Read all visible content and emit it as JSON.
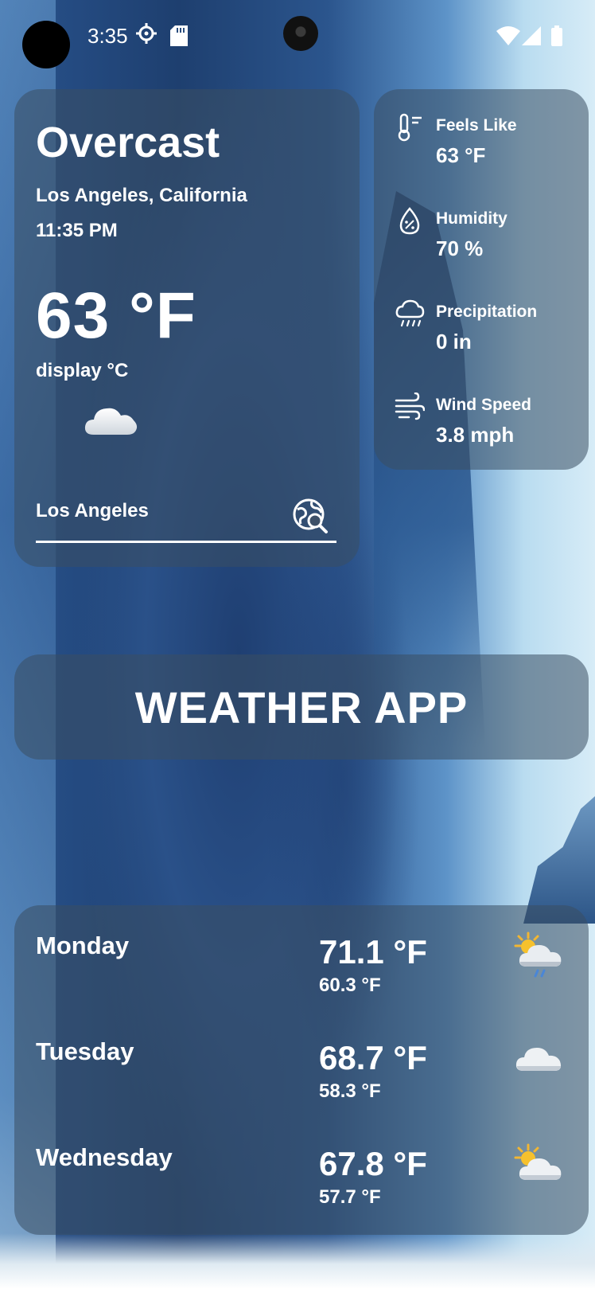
{
  "status_bar": {
    "time": "3:35"
  },
  "current": {
    "condition": "Overcast",
    "location": "Los Angeles, California",
    "local_time": "11:35 PM",
    "temperature": "63 °F",
    "unit_toggle_label": "display °C",
    "search_value": "Los Angeles",
    "weather_icon": "cloud-icon"
  },
  "details": [
    {
      "label": "Feels Like",
      "value": "63 °F",
      "icon": "thermometer-icon"
    },
    {
      "label": "Humidity",
      "value": "70 %",
      "icon": "humidity-drop-icon"
    },
    {
      "label": "Precipitation",
      "value": "0 in",
      "icon": "rain-cloud-icon"
    },
    {
      "label": "Wind Speed",
      "value": "3.8 mph",
      "icon": "wind-icon"
    }
  ],
  "banner": {
    "title": "WEATHER APP"
  },
  "forecast": [
    {
      "day": "Monday",
      "high": "71.1 °F",
      "low": "60.3 °F",
      "icon": "sun-cloud-rain-icon"
    },
    {
      "day": "Tuesday",
      "high": "68.7 °F",
      "low": "58.3 °F",
      "icon": "cloud-icon"
    },
    {
      "day": "Wednesday",
      "high": "67.8 °F",
      "low": "57.7 °F",
      "icon": "partly-sunny-icon"
    }
  ]
}
